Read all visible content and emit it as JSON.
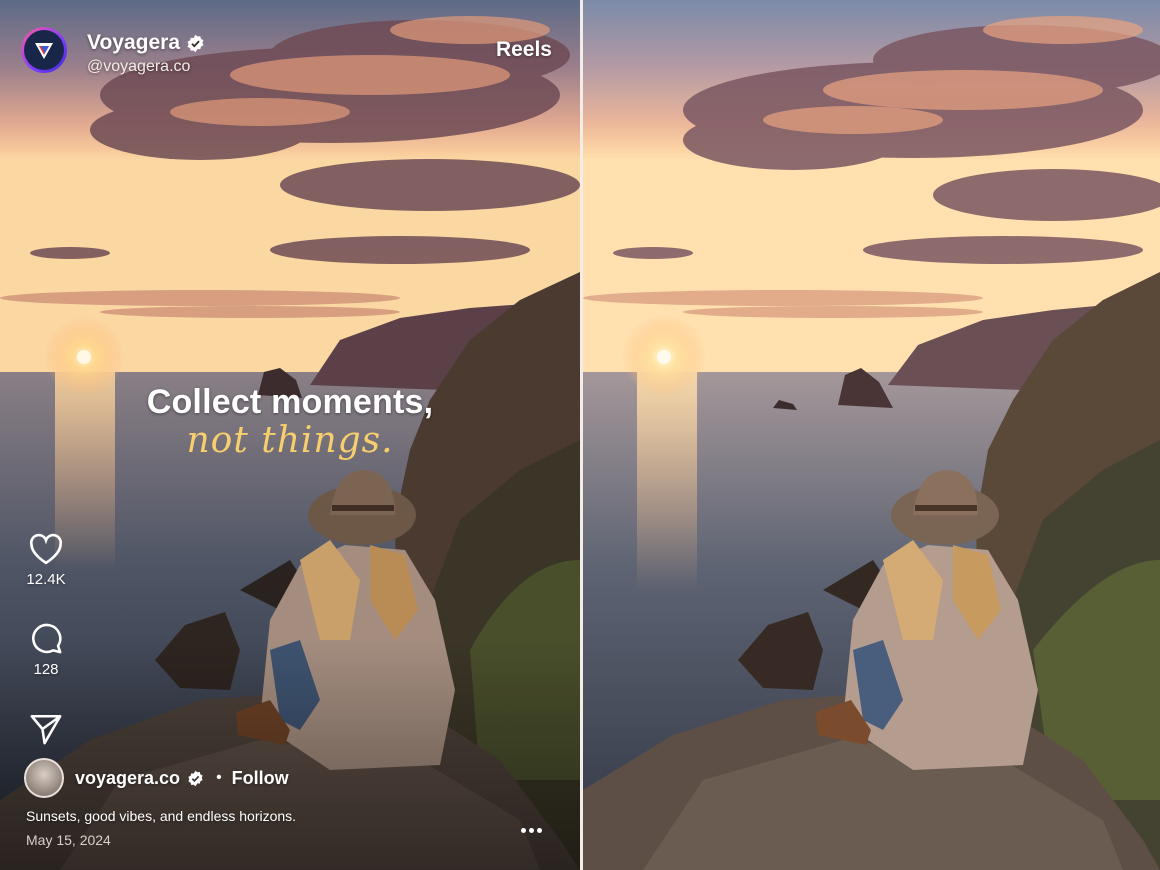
{
  "header": {
    "brand_name": "Voyagera",
    "brand_handle": "@voyagera.co",
    "reels_label": "Reels"
  },
  "headline": {
    "main": "Collect moments,",
    "script": "not things."
  },
  "actions": {
    "likes": "12.4K",
    "comments": "128"
  },
  "profile": {
    "name": "voyagera.co",
    "follow_label": "Follow",
    "separator": "•"
  },
  "post": {
    "caption": "Sunsets, good vibes, and endless horizons.",
    "date": "May 15, 2024"
  },
  "colors": {
    "accent_script": "#f7cf6d",
    "verified": "#ffffff"
  },
  "icons": [
    "verified-icon",
    "heart-icon",
    "comment-icon",
    "send-icon",
    "more-icon",
    "brand-logo-icon"
  ]
}
